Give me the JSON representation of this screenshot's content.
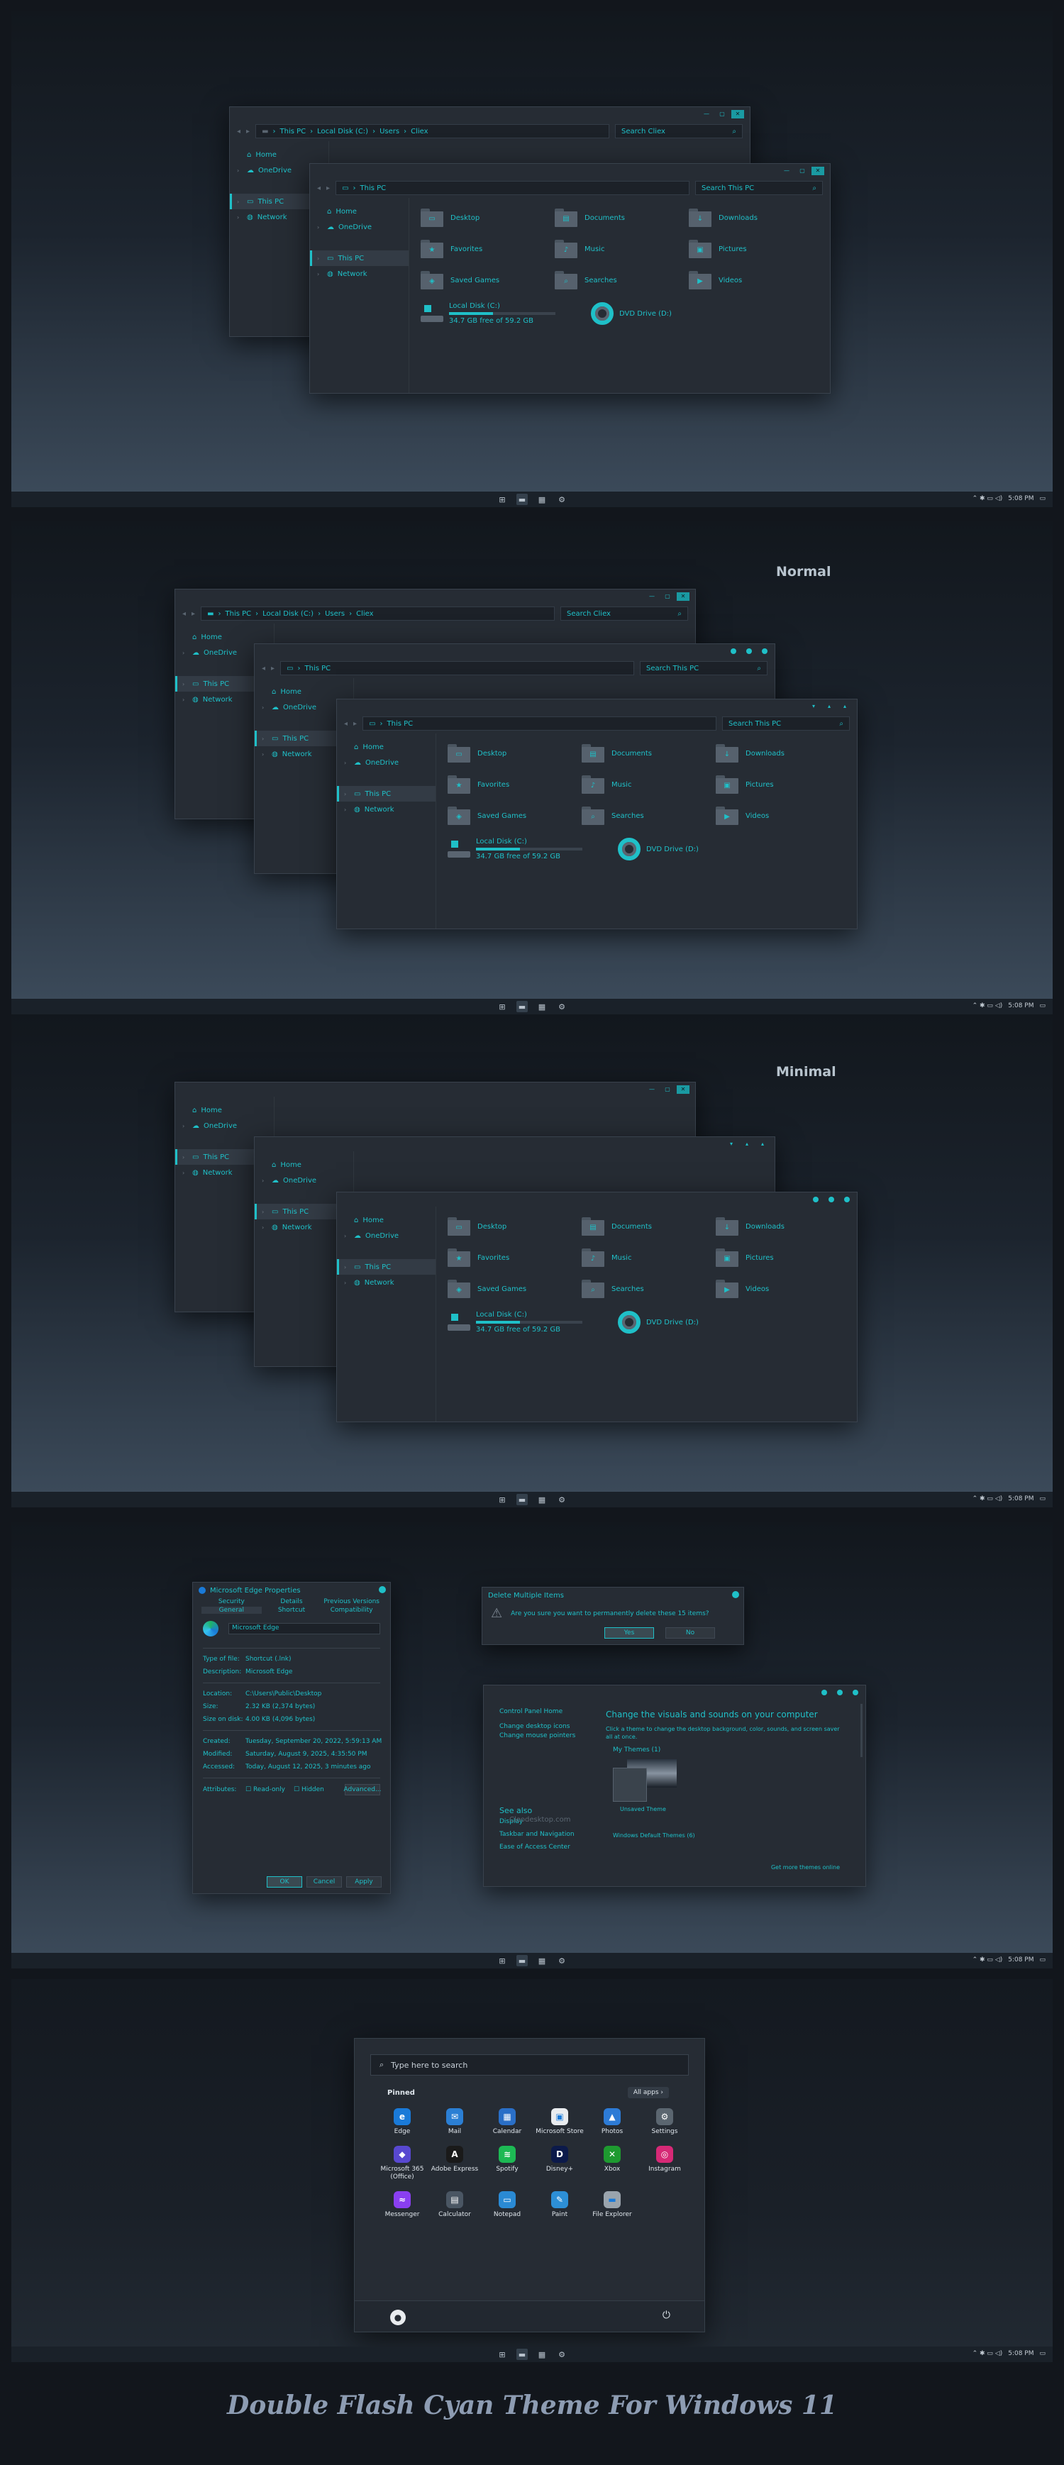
{
  "explorer": {
    "path_back": [
      "This PC",
      "Local Disk (C:)",
      "Users",
      "Cliex"
    ],
    "path_front": [
      "This PC"
    ],
    "search_back": "Search Cliex",
    "search_front": "Search This PC",
    "sidebar": [
      "Home",
      "OneDrive",
      "This PC",
      "Network"
    ],
    "folders": [
      "Desktop",
      "Documents",
      "Downloads",
      "Favorites",
      "Music",
      "Pictures",
      "Saved Games",
      "Searches",
      "Videos"
    ],
    "drive_c_name": "Local Disk (C:)",
    "drive_c_free": "34.7 GB free of 59.2 GB",
    "drive_c_used_fraction": 0.41,
    "dvd_name": "DVD Drive (D:)"
  },
  "taskbar": {
    "time": "5:08 PM",
    "tray_glyphs": "⌃ ✱ ▭ ◁)"
  },
  "labels": {
    "normal": "Normal",
    "minimal": "Minimal"
  },
  "props": {
    "title": "Microsoft Edge Properties",
    "tabs": [
      "Security",
      "Details",
      "Previous Versions",
      "General",
      "Shortcut",
      "Compatibility"
    ],
    "name": "Microsoft Edge",
    "rows1": [
      [
        "Type of file:",
        "Shortcut (.lnk)"
      ],
      [
        "Description:",
        "Microsoft Edge"
      ]
    ],
    "rows2": [
      [
        "Location:",
        "C:\\Users\\Public\\Desktop"
      ],
      [
        "Size:",
        "2.32 KB (2,374 bytes)"
      ],
      [
        "Size on disk:",
        "4.00 KB (4,096 bytes)"
      ]
    ],
    "rows3": [
      [
        "Created:",
        "Tuesday, September 20, 2022, 5:59:13 AM"
      ],
      [
        "Modified:",
        "Saturday, August 9, 2025, 4:35:50 PM"
      ],
      [
        "Accessed:",
        "Today, August 12, 2025, 3 minutes ago"
      ]
    ],
    "attributes_label": "Attributes:",
    "readonly": "Read-only",
    "hidden": "Hidden",
    "advanced": "Advanced...",
    "ok": "OK",
    "cancel": "Cancel",
    "apply": "Apply"
  },
  "delete_dialog": {
    "title": "Delete Multiple Items",
    "message": "Are you sure you want to permanently delete these 15 items?",
    "yes": "Yes",
    "no": "No"
  },
  "personalize": {
    "home": "Control Panel Home",
    "links": [
      "Change desktop icons",
      "Change mouse pointers"
    ],
    "heading": "Change the visuals and sounds on your computer",
    "sub": "Click a theme to change the desktop background, color, sounds, and screen saver all at once.",
    "my_themes": "My Themes (1)",
    "theme_name": "Unsaved Theme",
    "get_more": "Get more themes online",
    "default": "Windows Default Themes (6)",
    "watermark": "Cleodesktop.com",
    "see_also": "See also",
    "see_links": [
      "Display",
      "Taskbar and Navigation",
      "Ease of Access Center"
    ]
  },
  "start": {
    "search_placeholder": "Type here to search",
    "pinned": "Pinned",
    "all_apps": "All apps  ›",
    "apps": [
      {
        "name": "Edge",
        "color": "#1a7ad8",
        "glyph": "e"
      },
      {
        "name": "Mail",
        "color": "#2b7fd4",
        "glyph": "✉"
      },
      {
        "name": "Calendar",
        "color": "#2a6fc7",
        "glyph": "▦"
      },
      {
        "name": "Microsoft Store",
        "color": "#e9ecef",
        "glyph": "▣"
      },
      {
        "name": "Photos",
        "color": "#2d7bd6",
        "glyph": "▲"
      },
      {
        "name": "Settings",
        "color": "#5b6670",
        "glyph": "⚙"
      },
      {
        "name": "Microsoft 365 (Office)",
        "color": "#5848d0",
        "glyph": "◆"
      },
      {
        "name": "Adobe Express",
        "color": "#1a1a1a",
        "glyph": "A"
      },
      {
        "name": "Spotify",
        "color": "#1db954",
        "glyph": "≋"
      },
      {
        "name": "Disney+",
        "color": "#0c1a4a",
        "glyph": "D"
      },
      {
        "name": "Xbox",
        "color": "#1e9a30",
        "glyph": "✕"
      },
      {
        "name": "Instagram",
        "color": "#d62976",
        "glyph": "◎"
      },
      {
        "name": "Messenger",
        "color": "#8a3ff0",
        "glyph": "≈"
      },
      {
        "name": "Calculator",
        "color": "#4a5663",
        "glyph": "▤"
      },
      {
        "name": "Notepad",
        "color": "#2a8ad4",
        "glyph": "▭"
      },
      {
        "name": "Paint",
        "color": "#2d8fd6",
        "glyph": "✎"
      },
      {
        "name": "File Explorer",
        "color": "#9aa4ad",
        "glyph": "▬"
      }
    ]
  },
  "footer_title": "Double Flash Cyan Theme For Windows 11"
}
